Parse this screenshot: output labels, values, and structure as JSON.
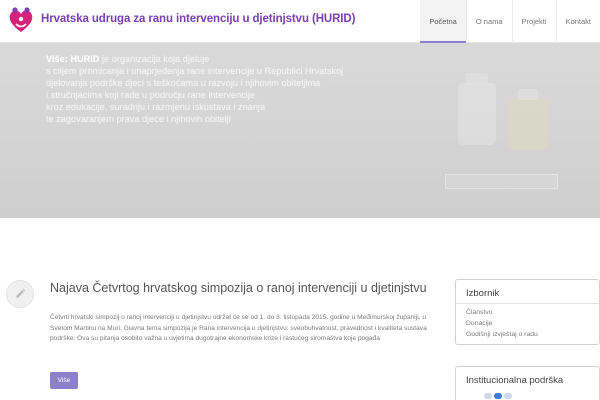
{
  "header": {
    "site_title": "Hrvatska udruga za ranu intervenciju u djetinjstvu (HURID)"
  },
  "nav": {
    "items": [
      {
        "label": "Početna",
        "active": true
      },
      {
        "label": "O nama",
        "active": false
      },
      {
        "label": "Projekti",
        "active": false
      },
      {
        "label": "Kontakt",
        "active": false
      }
    ]
  },
  "hero": {
    "lead": "Više: HURID",
    "text_lines": [
      "je organizacija koja djeluje",
      "s ciljem promicanja i unaprjeđenja rane intervencije u Republici Hrvatskoj",
      "djelovanja podrške djeci s teškoćama u razvoju i njihovim obiteljima",
      "i stručnjacima koji rade u području rane intervencije",
      "kroz edukacije, suradnju i razmjenu iskustava i znanja",
      "te zagovaranjem prava djece i njihovih obitelji"
    ]
  },
  "post": {
    "title": "Najava Četvrtog hrvatskog simpozija o ranoj intervenciji u djetinjstvu",
    "excerpt": "Četvrti hrvatski simpozij o ranoj intervenciji u djetinjstvu održat će se od 1. do 3. listopada 2015. godine u Međimurskoj županiji, u Svetom Martinu na Muri. Glavna tema simpozija je Rana intervencija u djetinjstvu: sveobuhvatnost, pravednost i kvaliteta sustava podrške. Ova su pitanja osobito važna u uvjetima dugotrajne ekonomske krize i rastućeg siromaštva koje pogađa",
    "more_label": "Više"
  },
  "sidebar": {
    "menu_title": "Izbornik",
    "menu_items": [
      "Članstvo",
      "Donacije",
      "Godišnji izvještaj o radu"
    ],
    "support_title": "Institucionalna podrška"
  },
  "colors": {
    "brand": "#7a3fb0",
    "accent": "#8b80c9",
    "logo_pink": "#d4237a"
  }
}
